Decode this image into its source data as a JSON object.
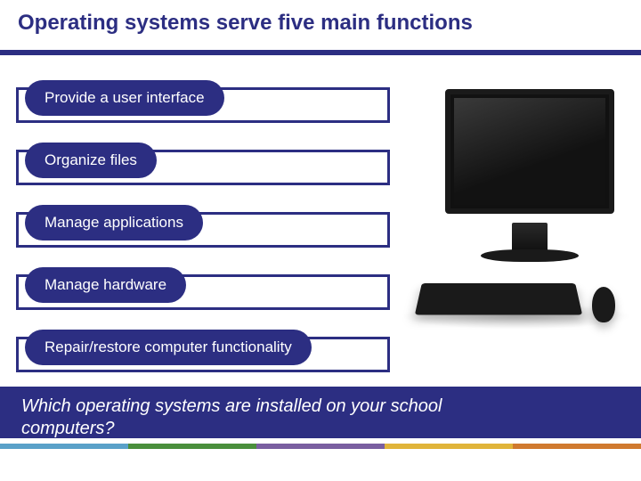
{
  "title": "Operating systems serve five main functions",
  "functions": [
    "Provide a user interface",
    "Organize files",
    "Manage applications",
    "Manage hardware",
    "Repair/restore computer functionality"
  ],
  "question": "Which operating systems are installed on your school computers?",
  "accent_color": "#2c2e82",
  "strip_colors": [
    "#5aa1c9",
    "#4a8f3c",
    "#7a5fa0",
    "#e0b43a",
    "#d07a2f"
  ]
}
